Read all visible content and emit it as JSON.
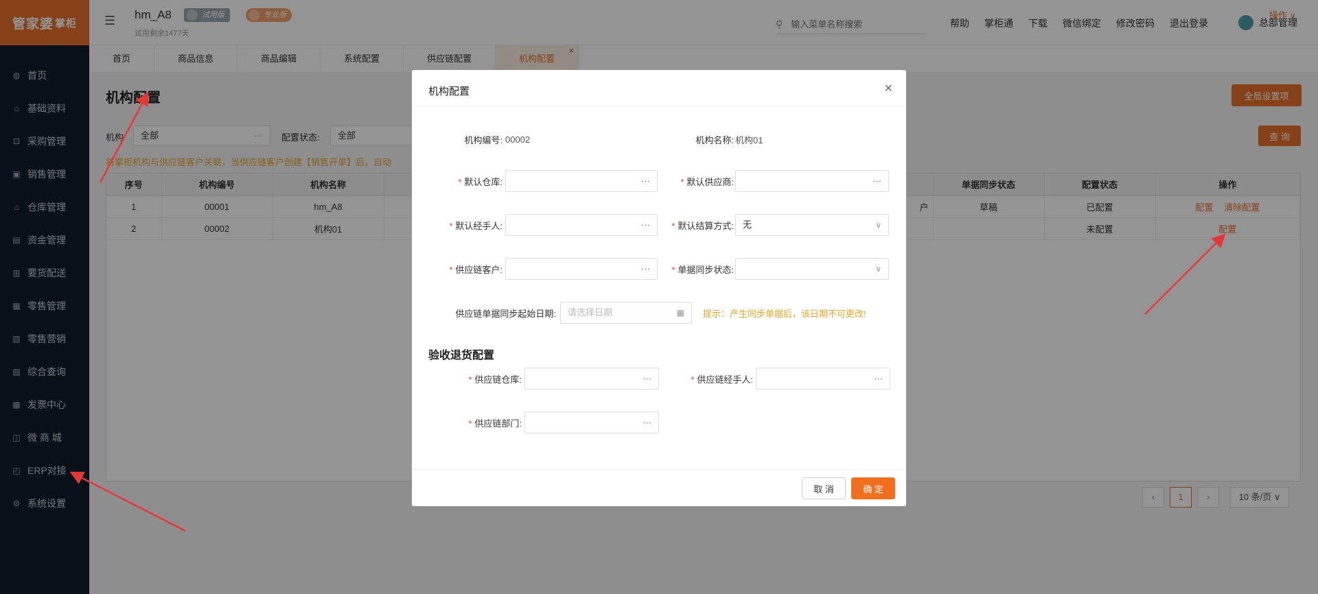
{
  "app": {
    "logo_text": "管家婆",
    "logo_sub": "掌柜",
    "store_name": "hm_A8",
    "badge_trial": "试用版",
    "badge_pro": "专业版",
    "trial_remaining": "试用剩余1477天"
  },
  "sidebar": {
    "items": [
      {
        "label": "首页",
        "icon": "globe-icon",
        "glyph": "◍"
      },
      {
        "label": "基础资料",
        "icon": "home-icon",
        "glyph": "⌂"
      },
      {
        "label": "采购管理",
        "icon": "cart-icon",
        "glyph": "⊡"
      },
      {
        "label": "销售管理",
        "icon": "sales-icon",
        "glyph": "▣"
      },
      {
        "label": "仓库管理",
        "icon": "warehouse-icon",
        "glyph": "⌂"
      },
      {
        "label": "资金管理",
        "icon": "fund-icon",
        "glyph": "▤"
      },
      {
        "label": "要货配送",
        "icon": "delivery-icon",
        "glyph": "▥"
      },
      {
        "label": "零售管理",
        "icon": "retail-icon",
        "glyph": "▦"
      },
      {
        "label": "零售营销",
        "icon": "gift-icon",
        "glyph": "▧"
      },
      {
        "label": "综合查询",
        "icon": "query-icon",
        "glyph": "▨"
      },
      {
        "label": "发票中心",
        "icon": "invoice-icon",
        "glyph": "▩"
      },
      {
        "label": "微 商 城",
        "icon": "shop-icon",
        "glyph": "◫"
      },
      {
        "label": "ERP对接",
        "icon": "erp-icon",
        "glyph": "◰"
      },
      {
        "label": "系统设置",
        "icon": "settings-icon",
        "glyph": "⚙"
      }
    ]
  },
  "header": {
    "search_placeholder": "输入菜单名称搜索",
    "links": [
      "帮助",
      "掌柜通",
      "下载",
      "微信绑定",
      "修改密码",
      "退出登录"
    ],
    "user_name": "总部管理"
  },
  "tabs": {
    "items": [
      "首页",
      "商品信息",
      "商品编辑",
      "系统配置",
      "供应链配置",
      "机构配置"
    ],
    "active_index": 5,
    "ops_label": "操作 ∨"
  },
  "main": {
    "page_title": "机构配置",
    "global_settings_label": "全局设置项",
    "filter_org_label": "机构",
    "filter_org_value": "全部",
    "filter_status_label": "配置状态:",
    "filter_status_value": "全部",
    "query_label": "查 询",
    "notice": "将掌柜机构与供应链客户关联，当供应链客户创建【销售开单】后，自动",
    "columns_left": [
      "序号",
      "机构编号",
      "机构名称"
    ],
    "columns_right": [
      "单据同步状态",
      "配置状态",
      "操作"
    ],
    "rows": [
      {
        "index": "1",
        "code": "00001",
        "name": "hm_A8",
        "partial": "户",
        "sync": "草稿",
        "status": "已配置",
        "actions": [
          "配置",
          "清除配置"
        ]
      },
      {
        "index": "2",
        "code": "00002",
        "name": "机构01",
        "partial": "",
        "sync": "",
        "status": "未配置",
        "actions": [
          "配置"
        ]
      }
    ],
    "pager": {
      "current": "1",
      "page_size": "10 条/页"
    }
  },
  "modal": {
    "title": "机构配置",
    "org_code_label": "机构编号:",
    "org_code_value": "00002",
    "org_name_label": "机构名称:",
    "org_name_value": "机构01",
    "default_warehouse_label": "默认仓库:",
    "default_supplier_label": "默认供应商:",
    "default_handler_label": "默认经手人:",
    "default_settlement_label": "默认结算方式:",
    "default_settlement_value": "无",
    "supply_customer_label": "供应链客户:",
    "doc_sync_status_label": "单据同步状态:",
    "sync_start_date_label": "供应链单据同步起始日期:",
    "sync_start_date_placeholder": "请选择日期",
    "hint": "提示：产生同步单据后，该日期不可更改!",
    "section_title": "验收退货配置",
    "supply_warehouse_label": "供应链仓库:",
    "supply_handler_label": "供应链经手人:",
    "supply_department_label": "供应链部门:",
    "cancel_label": "取 消",
    "ok_label": "确 定"
  },
  "colors": {
    "accent": "#e8702a",
    "sidebar_bg": "#0f1e2e",
    "hint": "#e8a42a",
    "annotation_arrow": "#e53935"
  }
}
